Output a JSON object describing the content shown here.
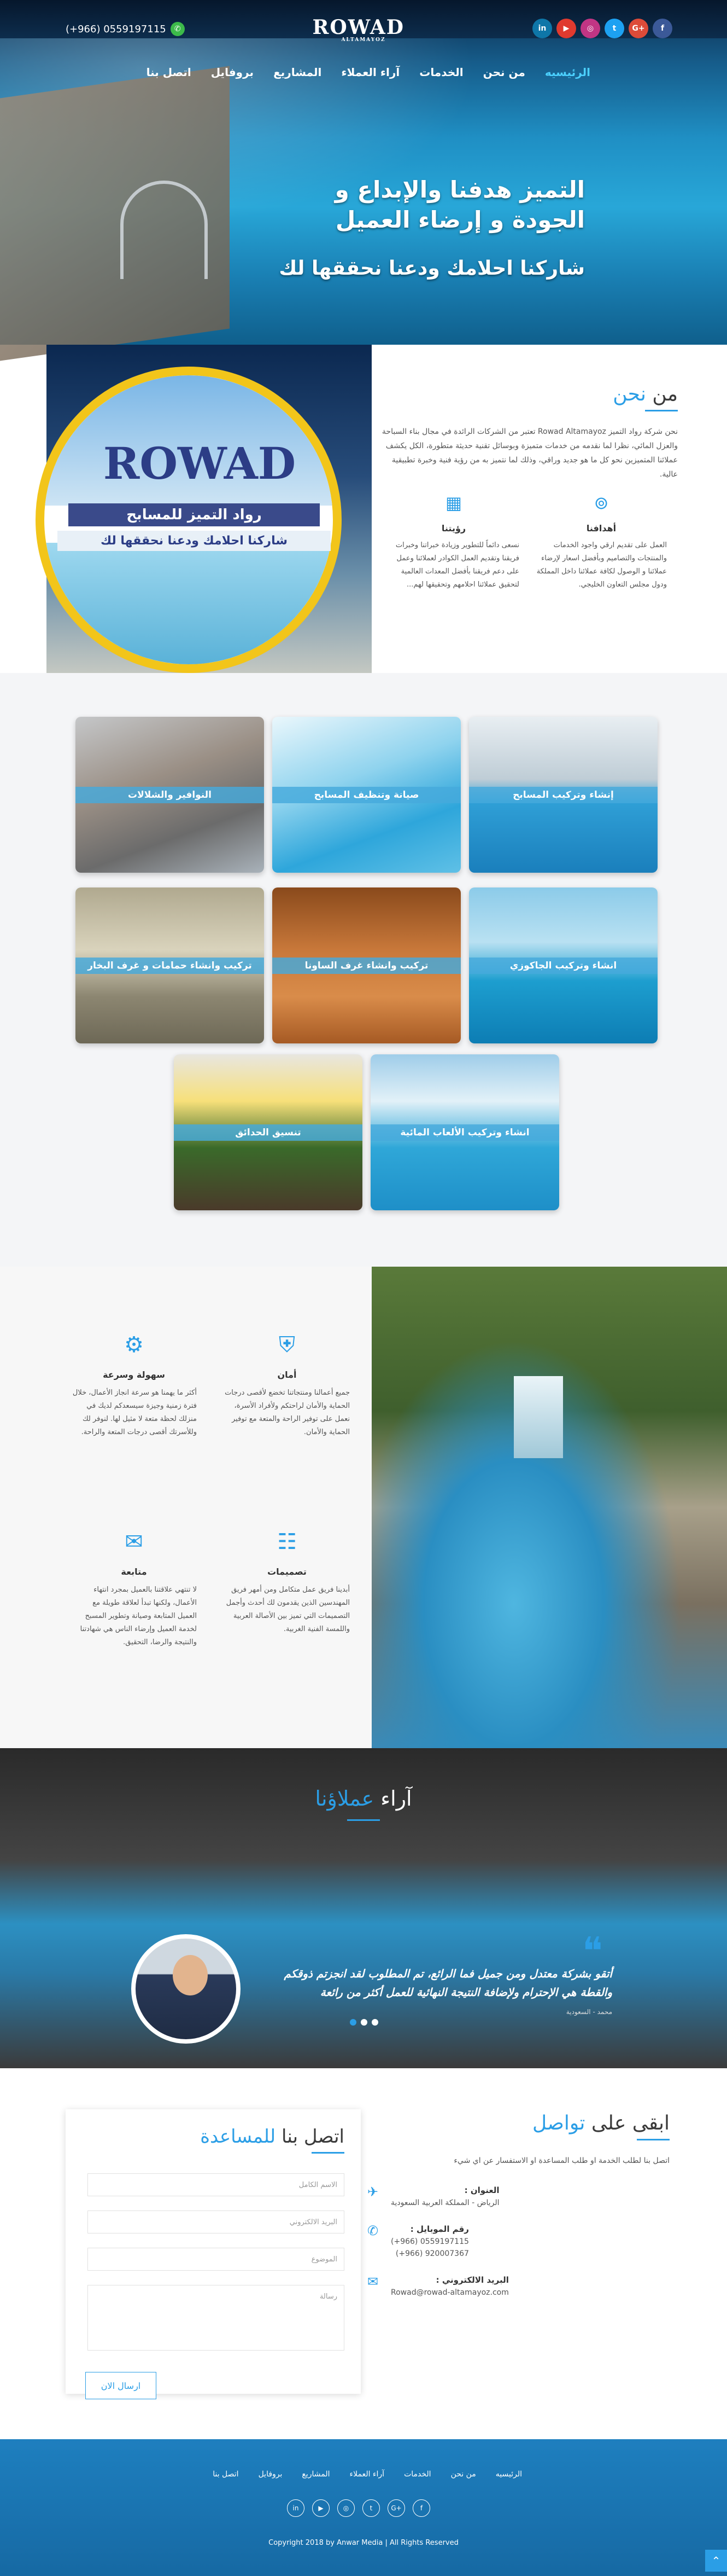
{
  "header": {
    "phone": "(+966) 0559197115",
    "whatsapp_icon": "whatsapp-icon",
    "logo_text": "ROWAD",
    "logo_sub": "ALTAMAYOZ",
    "socials": [
      {
        "label": "in",
        "icon": "linkedin-icon",
        "color": "#0e76a8"
      },
      {
        "label": "▶",
        "icon": "youtube-icon",
        "color": "#e03a2f"
      },
      {
        "label": "◎",
        "icon": "instagram-icon",
        "color": "#c13584"
      },
      {
        "label": "t",
        "icon": "twitter-icon",
        "color": "#1da1f2"
      },
      {
        "label": "G+",
        "icon": "googleplus-icon",
        "color": "#dd4b39"
      },
      {
        "label": "f",
        "icon": "facebook-icon",
        "color": "#3b5998"
      }
    ],
    "nav": [
      "الرئيسيه",
      "من نحن",
      "الخدمات",
      "آراء العملاء",
      "المشاريع",
      "بروفايل",
      "اتصل بنا"
    ],
    "hero_title": "التميز هدفنا والإبداع و الجودة و إرضاء العميل",
    "hero_sub": "شاركنا احلامك ودعنا نحققها لك"
  },
  "about": {
    "image_brand": "ROWAD",
    "image_line1": "رواد التميز للمسابح",
    "image_line2": "شاركنا احلامك ودعنا نحققها لك",
    "title_pre": "من",
    "title_hl": "نحن",
    "text": "نحن شركة رواد التميز Rowad Altamayoz تعتبر من الشركات الرائدة في مجال بناء السباحة والعزل المائي، نظرا لما نقدمه من خدمات متميزة وبوسائل تقنية حديثة متطورة، الكل يكشف عملائنا المتميزين نحو كل ما هو جديد وراقي، وذلك لما نتميز به من رؤية فنية وخبرة تطبيقية عالية.",
    "vision_title": "رؤيتنا",
    "vision_text": "نسعى دائماً للتطوير وزيادة خبراتنا وخبرات فريقنا وتقديم العمل الكوادر لعملائنا وعمل على دعم فريقنا بأفضل المعدات العالمية لتحقيق عملائنا احلامهم وتحقيقها لهم...",
    "goals_title": "أهدافنا",
    "goals_text": "العمل على تقديم ارقي واجود الخدمات والمنتجات والتصاميم وبأفضل اسعار لإرضاء عملائنا و الوصول لكافة عملائنا داخل المملكة ودول مجلس التعاون الخليجي."
  },
  "services": [
    {
      "label": "إنشاء وتركيب المسابح",
      "bg": "linear-gradient(180deg,#e8eef2 0%,#bfcdd6 40%,#2f9fd6 55%,#1a7fbc 100%)"
    },
    {
      "label": "صيانة وتنظيف المسابح",
      "bg": "linear-gradient(160deg,#eaf7fc 0%,#8fd3ee 40%,#2ea6db 70%,#5fc0e6 100%)"
    },
    {
      "label": "النوافير والشلالات",
      "bg": "linear-gradient(160deg,#c5c7c9 0%,#9a8f85 40%,#6b6b6b 70%,#a9b2ba 100%)"
    },
    {
      "label": "انشاء وتركيب الجاكوزي",
      "bg": "linear-gradient(180deg,#8ccbe9 0%,#b9e1f2 35%,#1d9ecf 60%,#0d7db4 100%)"
    },
    {
      "label": "تركيب وانشاء غرف الساونا",
      "bg": "linear-gradient(180deg,#8a4a1c 0%,#c8783a 40%,#d98c4a 70%,#a65a24 100%)"
    },
    {
      "label": "تركيب وانشاء حمامات و غرف البخار",
      "bg": "linear-gradient(180deg,#b0a98f 0%,#d9d3bc 40%,#8c8671 70%,#6d6856 100%)"
    },
    {
      "label": "انشاء وتركيب الألعاب المائية",
      "bg": "linear-gradient(180deg,#9fcde9 0%,#e2f1f8 30%,#2fa7d8 60%,#1e8fc8 100%)"
    },
    {
      "label": "تنسيق الحدائق",
      "bg": "linear-gradient(180deg,#e8e6e0 0%,#f7e07a 30%,#3a6a2a 60%,#4a3a2a 100%)"
    }
  ],
  "features": [
    {
      "icon": "shield-icon",
      "title": "أمان",
      "text": "جميع أعمالنا ومنتجاتنا تخضع لأقصى درجات الحماية والأمان لراحتكم ولأفراد الأسرة، نعمل على توفير الراحة والمتعة مع توفير الحماية والأمان."
    },
    {
      "icon": "lightning-icon",
      "title": "سهولة وسرعة",
      "text": "أكثر ما يهمنا هو سرعة انجاز الأعمال، خلال فترة زمنية وجيزة سيسعدكم لديك في منزلك لحظة متعة لا مثيل لها. لنوفر لك وللأسرتك أقصى درجات المتعة والراحة."
    },
    {
      "icon": "team-icon",
      "title": "تصميمات",
      "text": "أبدينا فريق عمل متكامل ومن أمهر فريق المهندسين الذين يقدمون لك أحدث وأجمل التصميمات التي تميز بين الأصالة العربية واللمسة الفنية الغربية."
    },
    {
      "icon": "chat-icon",
      "title": "متابعة",
      "text": "لا تنتهي علاقتنا بالعميل بمجرد انتهاء الأعمال، ولكنها تبدأ لعلاقة طويلة مع العميل المتابعة وصيانة وتطوير المسبح لخدمة العميل وإرضاء الناس هي شهادتنا والنتيجة والرضا، التحقيق."
    }
  ],
  "testimonials": {
    "title_pre": "آراء",
    "title_hl": "عملاؤنا",
    "quote": "أتقو بشركة معتدل ومن جميل فما الرائع، تم المطلوب لقد انجزتم ذوقكم والقطة هي الإحترام ولإضافة النتيجة النهائية للعمل أكثر من رائعة",
    "author": "محمد - السعودية"
  },
  "contact": {
    "title_pre": "ابقى على",
    "title_hl": "تواصل",
    "intro": "اتصل بنا لطلب الخدمة او طلب المساعدة او الاستفسار عن اي شيء",
    "address_label": "العنوان :",
    "address": "الرياض - المملكة العربية السعودية",
    "phone_label": "رقم الموبايل :",
    "phone1": "(+966) 0559197115",
    "phone2": "(+966) 920007367",
    "email_label": "البريد الالكتروني :",
    "email": "Rowad@rowad-altamayoz.com"
  },
  "form": {
    "title_pre": "اتصل بنا",
    "title_hl": "للمساعدة",
    "name_ph": "الاسم الكامل",
    "email_ph": "البريد الالكتروني",
    "subject_ph": "الموضوع",
    "message_ph": "رسالة",
    "send": "ارسال الان"
  },
  "footer": {
    "nav": [
      "الرئيسيه",
      "من نحن",
      "الخدمات",
      "آراء العملاء",
      "المشاريع",
      "بروفايل",
      "اتصل بنا"
    ],
    "socials": [
      "in",
      "▶",
      "◎",
      "t",
      "G+",
      "f"
    ],
    "copyright": "Copyright 2018 by Anwar Media | All Rights Reserved"
  }
}
